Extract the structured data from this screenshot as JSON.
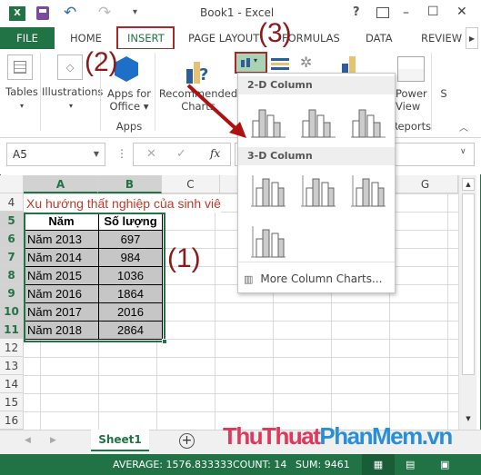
{
  "titlebar": {
    "title": "Book1 - Excel",
    "help": "?",
    "minimize": "–",
    "maximize": "☐",
    "close": "✕"
  },
  "tabs": [
    {
      "label": "FILE"
    },
    {
      "label": "HOME"
    },
    {
      "label": "INSERT"
    },
    {
      "label": "PAGE LAYOUT"
    },
    {
      "label": "FORMULAS"
    },
    {
      "label": "DATA"
    },
    {
      "label": "REVIEW"
    }
  ],
  "ribbon": {
    "tables": "Tables",
    "illustrations": "Illustrations",
    "apps_for_office_1": "Apps for",
    "apps_for_office_2": "Office",
    "apps_group": "Apps",
    "recommended_1": "Recommended",
    "recommended_2": "Charts",
    "power_view_1": "Power",
    "power_view_2": "View",
    "reports_group": "Reports",
    "s_label": "S"
  },
  "formula_bar": {
    "name_box": "A5",
    "cancel": "✕",
    "enter": "✓",
    "fx": "fx",
    "value": ""
  },
  "columns": [
    "A",
    "B",
    "C",
    "D",
    "E",
    "F",
    "G"
  ],
  "rows": [
    "4",
    "5",
    "6",
    "7",
    "8",
    "9",
    "10",
    "11",
    "12",
    "13",
    "14",
    "15",
    "16"
  ],
  "sheet": {
    "title_cell": "Xu hướng thất nghiệp của sinh viê",
    "headers": [
      "Năm",
      "Số lượng"
    ],
    "data": [
      [
        "Năm 2013",
        "697"
      ],
      [
        "Năm 2014",
        "984"
      ],
      [
        "Năm 2015",
        "1036"
      ],
      [
        "Năm 2016",
        "1864"
      ],
      [
        "Năm 2017",
        "2016"
      ],
      [
        "Năm 2018",
        "2864"
      ]
    ]
  },
  "dropdown": {
    "section_2d": "2-D Column",
    "section_3d": "3-D Column",
    "more": "More Column Charts..."
  },
  "annotations": {
    "a1": "(1)",
    "a2": "(2)",
    "a3": "(3)"
  },
  "sheet_tabs": {
    "active": "Sheet1",
    "add": "+"
  },
  "status": {
    "average": "AVERAGE: 1576.833333",
    "count": "COUNT: 14",
    "sum": "SUM: 9461"
  },
  "watermark": {
    "part1": "ThuThuat",
    "part2": "PhanMem",
    "part3": ".vn"
  },
  "colors": {
    "excel_green": "#217346",
    "annotation_red": "#8b1a1a",
    "title_text_red": "#c0392b"
  }
}
